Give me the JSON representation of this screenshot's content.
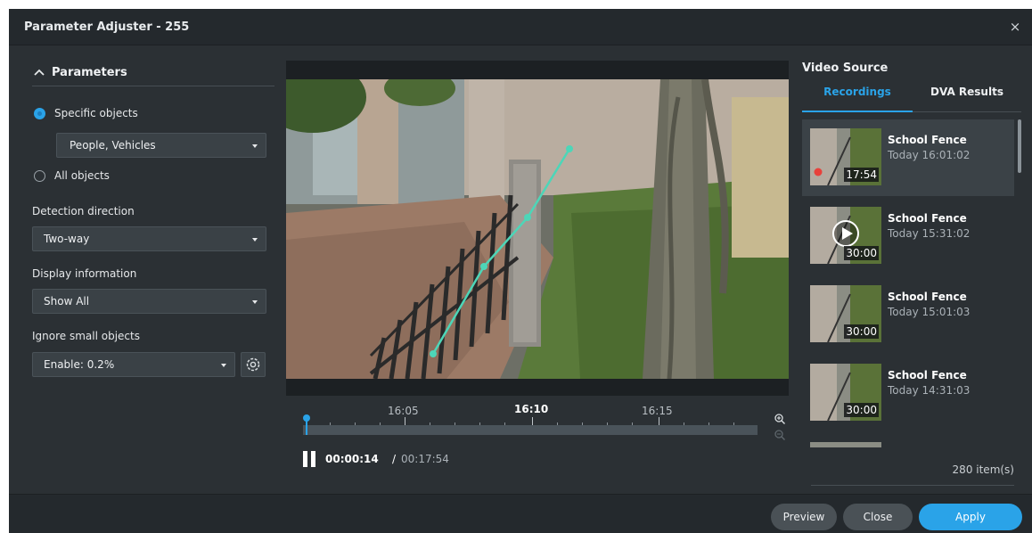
{
  "window": {
    "title": "Parameter Adjuster - 255",
    "close_label": "×"
  },
  "parameters": {
    "section_title": "Parameters",
    "radio_specific": "Specific objects",
    "specific_select": "People, Vehicles",
    "radio_all": "All objects",
    "selected": "specific",
    "detection_direction": {
      "label": "Detection direction",
      "value": "Two-way"
    },
    "display_information": {
      "label": "Display information",
      "value": "Show All"
    },
    "ignore_small_objects": {
      "label": "Ignore small objects",
      "value": "Enable: 0.2%"
    }
  },
  "timeline": {
    "labels": [
      "16:05",
      "16:10",
      "16:15"
    ],
    "current_label": "16:10"
  },
  "playback": {
    "current": "00:00:14",
    "separator": "/",
    "total": "00:17:54"
  },
  "video_source": {
    "title": "Video Source",
    "tabs": [
      "Recordings",
      "DVA Results"
    ],
    "active_tab": "Recordings",
    "items": [
      {
        "name": "School Fence",
        "time": "Today 16:01:02",
        "duration": "17:54",
        "recording": true
      },
      {
        "name": "School Fence",
        "time": "Today 15:31:02",
        "duration": "30:00",
        "playing": true
      },
      {
        "name": "School Fence",
        "time": "Today 15:01:03",
        "duration": "30:00"
      },
      {
        "name": "School Fence",
        "time": "Today 14:31:03",
        "duration": "30:00"
      }
    ],
    "count": "280 item(s)"
  },
  "footer": {
    "preview": "Preview",
    "close": "Close",
    "apply": "Apply"
  },
  "colors": {
    "accent": "#2aa3e8",
    "panel": "#2b3034",
    "line": "#4dd6b8"
  }
}
